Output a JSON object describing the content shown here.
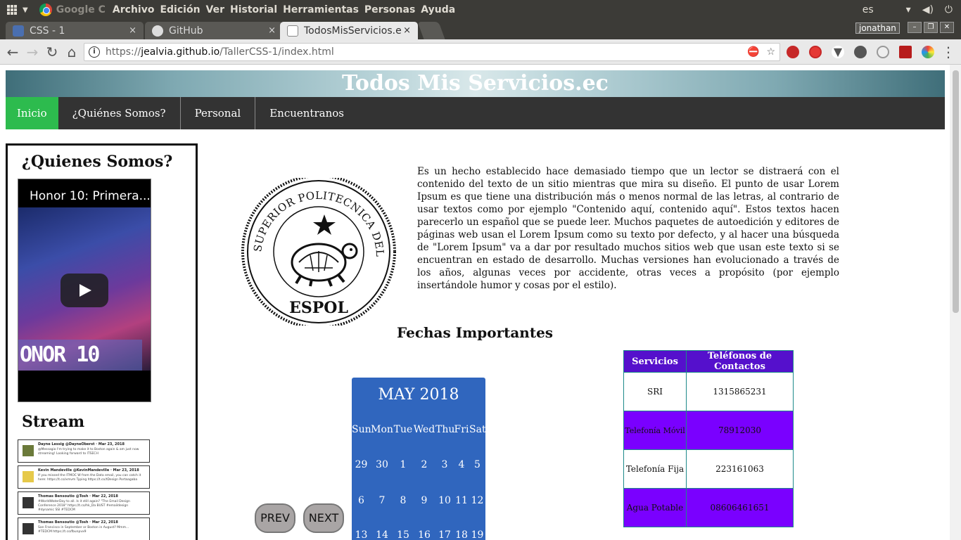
{
  "os": {
    "app_name": "Google C",
    "menu": [
      "Archivo",
      "Edición",
      "Ver",
      "Historial",
      "Herramientas",
      "Personas",
      "Ayuda"
    ],
    "lang": "es"
  },
  "browser": {
    "tabs": [
      {
        "title": "CSS - 1",
        "close": "×"
      },
      {
        "title": "GitHub",
        "close": "×"
      },
      {
        "title": "TodosMisServicios.e",
        "close": "×"
      }
    ],
    "profile": "jonathan",
    "url_scheme": "https://",
    "url_host": "jealvia.github.io",
    "url_path": "/TallerCSS-1/index.html"
  },
  "site": {
    "title": "Todos Mis Servicios.ec",
    "nav": [
      "Inicio",
      "¿Quiénes Somos?",
      "Personal",
      "Encuentranos"
    ]
  },
  "sidebar": {
    "heading": "¿Quienes Somos?",
    "video_title": "Honor 10: Primera...",
    "video_brand": "ONOR 10",
    "stream_heading": "Stream",
    "tweets": [
      {
        "name": "Dayne Lessig @DayneOberst · Mar 23, 2018",
        "text": "@Messagio I'm trying to make it to Boston again & am just now streaming! Looking forward to ITSECH"
      },
      {
        "name": "Kevin Mandeville @KevinMandeville · Mar 23, 2018",
        "text": "If you missed the ITMOC W from the Data email, you can catch it here: https://t.co/xmvm Typing https://t.co/tDesign Portaagaba"
      },
      {
        "name": "Thomas Bensoutio @Tosh · Mar 22, 2018",
        "text": "#WorldWaterDay to all. Is it still again? \"The Email Design Conference 2018\" https://t.co/hk_Da BUST #emaildesign #dynamic SSI #TEDCM"
      },
      {
        "name": "Thomas Bensoutio @Tosh · Mar 22, 2018",
        "text": "San Francisco in September or Boston in August? Mmm... #TEDCM https://t.co/fbunpvx9"
      }
    ]
  },
  "main": {
    "paragraph": "Es un hecho establecido hace demasiado tiempo que un lector se distraerá con el contenido del texto de un sitio mientras que mira su diseño. El punto de usar Lorem Ipsum es que tiene una distribución más o menos normal de las letras, al contrario de usar textos como por ejemplo \"Contenido aquí, contenido aquí\". Estos textos hacen parecerlo un español que se puede leer. Muchos paquetes de autoedición y editores de páginas web usan el Lorem Ipsum como su texto por defecto, y al hacer una búsqueda de \"Lorem Ipsum\" va a dar por resultado muchos sitios web que usan este texto si se encuentran en estado de desarrollo. Muchas versiones han evolucionado a través de los años, algunas veces por accidente, otras veces a propósito (por ejemplo insertándole humor y cosas por el estilo).",
    "seal_top": "ESCUELA SUPERIOR POLITECNICA DEL LITORAL",
    "seal_bottom": "ESPOL",
    "fechas_heading": "Fechas Importantes",
    "calendar": {
      "month": "MAY 2018",
      "weekdays": [
        "Sun",
        "Mon",
        "Tue",
        "Wed",
        "Thu",
        "Fri",
        "Sat"
      ],
      "weeks": [
        [
          "29",
          "30",
          "1",
          "2",
          "3",
          "4",
          "5"
        ],
        [
          "6",
          "7",
          "8",
          "9",
          "10",
          "11",
          "12"
        ],
        [
          "13",
          "14",
          "15",
          "16",
          "17",
          "18",
          "19"
        ]
      ],
      "prev": "PREV",
      "next": "NEXT"
    },
    "table": {
      "headers": [
        "Servicios",
        "Teléfonos de Contactos"
      ],
      "rows": [
        [
          "SRI",
          "1315865231"
        ],
        [
          "Telefonía Móvil",
          "78912030"
        ],
        [
          "Telefonía Fija",
          "223161063"
        ],
        [
          "Agua Potable",
          "08606461651"
        ]
      ]
    }
  },
  "colors": {
    "nav_active": "#2dbb4e",
    "nav_bg": "#333333",
    "calendar_bg": "#3066be",
    "table_header": "#5510cc",
    "table_alt": "#7a00ff"
  }
}
